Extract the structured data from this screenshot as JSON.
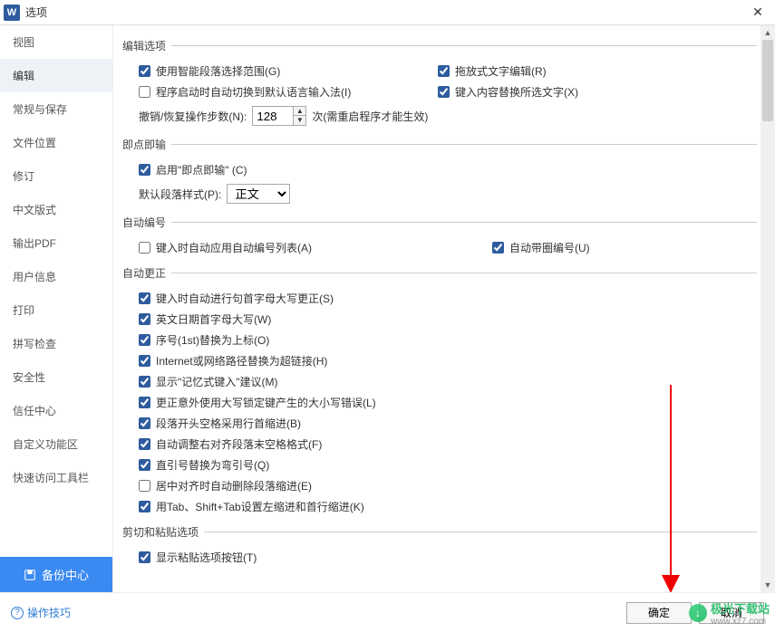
{
  "titlebar": {
    "title": "选项"
  },
  "sidebar": {
    "items": [
      {
        "label": "视图"
      },
      {
        "label": "编辑",
        "selected": true
      },
      {
        "label": "常规与保存"
      },
      {
        "label": "文件位置"
      },
      {
        "label": "修订"
      },
      {
        "label": "中文版式"
      },
      {
        "label": "输出PDF"
      },
      {
        "label": "用户信息"
      },
      {
        "label": "打印"
      },
      {
        "label": "拼写检查"
      },
      {
        "label": "安全性"
      },
      {
        "label": "信任中心"
      },
      {
        "label": "自定义功能区"
      },
      {
        "label": "快速访问工具栏"
      }
    ],
    "backup": "备份中心"
  },
  "sections": {
    "editOptions": {
      "legend": "编辑选项",
      "smartParagraph": {
        "label": "使用智能段落选择范围(G)",
        "checked": true
      },
      "dragText": {
        "label": "拖放式文字编辑(R)",
        "checked": true
      },
      "autoImeSwitch": {
        "label": "程序启动时自动切换到默认语言输入法(I)",
        "checked": false
      },
      "replaceSelection": {
        "label": "键入内容替换所选文字(X)",
        "checked": true
      },
      "undoSteps": {
        "label": "撤销/恢复操作步数(N):",
        "value": "128",
        "suffix": "次(需重启程序才能生效)"
      }
    },
    "clickType": {
      "legend": "即点即输",
      "enable": {
        "label": "启用\"即点即输\" (C)",
        "checked": true
      },
      "defaultStyle": {
        "label": "默认段落样式(P):",
        "value": "正文"
      }
    },
    "autoNumber": {
      "legend": "自动编号",
      "applyList": {
        "label": "键入时自动应用自动编号列表(A)",
        "checked": false
      },
      "circleNumber": {
        "label": "自动带圈编号(U)",
        "checked": true
      }
    },
    "autoCorrect": {
      "legend": "自动更正",
      "items": [
        {
          "label": "键入时自动进行句首字母大写更正(S)",
          "checked": true
        },
        {
          "label": "英文日期首字母大写(W)",
          "checked": true
        },
        {
          "label": "序号(1st)替换为上标(O)",
          "checked": true
        },
        {
          "label": "Internet或网络路径替换为超链接(H)",
          "checked": true
        },
        {
          "label": "显示\"记忆式键入\"建议(M)",
          "checked": true
        },
        {
          "label": "更正意外使用大写锁定键产生的大小写错误(L)",
          "checked": true
        },
        {
          "label": "段落开头空格采用行首缩进(B)",
          "checked": true
        },
        {
          "label": "自动调整右对齐段落末空格格式(F)",
          "checked": true
        },
        {
          "label": "直引号替换为弯引号(Q)",
          "checked": true
        },
        {
          "label": "居中对齐时自动删除段落缩进(E)",
          "checked": false
        },
        {
          "label": "用Tab、Shift+Tab设置左缩进和首行缩进(K)",
          "checked": true
        }
      ]
    },
    "cutPaste": {
      "legend": "剪切和粘贴选项",
      "showPasteBtn": {
        "label": "显示粘贴选项按钮(T)",
        "checked": true
      }
    }
  },
  "footer": {
    "help": "操作技巧",
    "ok": "确定",
    "cancel": "取消"
  },
  "watermark": {
    "text1": "极光下载站",
    "text2": "www.xz7.com"
  }
}
